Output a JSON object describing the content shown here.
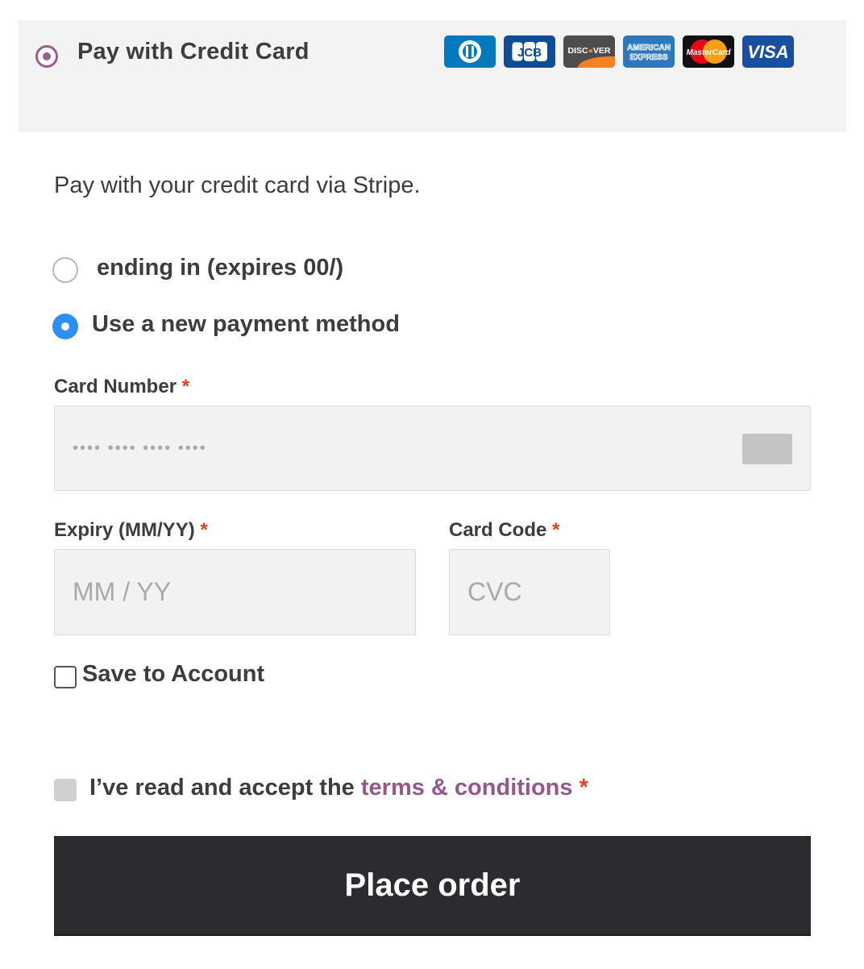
{
  "payment_method": {
    "title": "Pay with Credit Card",
    "selected": true,
    "card_brands": [
      {
        "name": "diners-club-icon",
        "label": "D"
      },
      {
        "name": "jcb-icon",
        "label": "JCB"
      },
      {
        "name": "discover-icon",
        "label": "DISCOVER"
      },
      {
        "name": "amex-icon",
        "label": "AMERICAN EXPRESS"
      },
      {
        "name": "mastercard-icon",
        "label": "MasterCard"
      },
      {
        "name": "visa-icon",
        "label": "VISA"
      }
    ],
    "description": "Pay with your credit card via Stripe."
  },
  "saved_method": {
    "label": "ending in (expires 00/)",
    "selected": false
  },
  "new_method": {
    "label": "Use a new payment method",
    "selected": true
  },
  "card_number": {
    "label": "Card Number",
    "required_marker": "*",
    "placeholder": "•••• •••• •••• ••••"
  },
  "expiry": {
    "label": "Expiry (MM/YY)",
    "required_marker": "*",
    "placeholder": "MM / YY"
  },
  "card_code": {
    "label": "Card Code",
    "required_marker": "*",
    "placeholder": "CVC"
  },
  "save_to_account": {
    "label": "Save to Account",
    "checked": false
  },
  "terms": {
    "prefix": "I’ve read and accept the",
    "link_text": "terms & conditions",
    "required_marker": "*",
    "checked": false
  },
  "place_order": {
    "label": "Place order"
  },
  "colors": {
    "accent": "#96588a",
    "selected_radio": "#2f8ef5",
    "button_bg": "#2b2c30",
    "required": "#e2401c"
  }
}
